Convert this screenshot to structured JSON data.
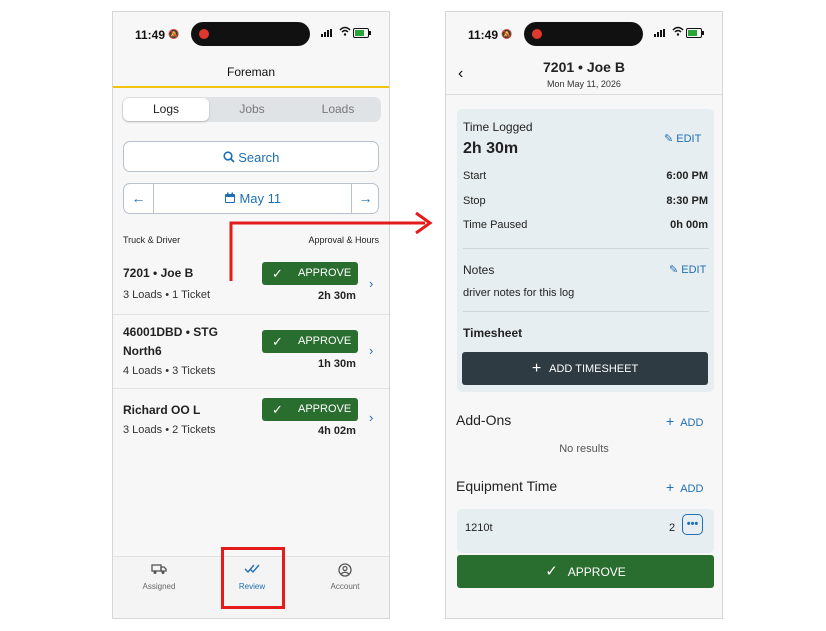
{
  "status": {
    "time": "11:49"
  },
  "left": {
    "header_title": "Foreman",
    "segments": [
      "Logs",
      "Jobs",
      "Loads"
    ],
    "search_label": "Search",
    "date_label": "May 11",
    "col_left": "Truck & Driver",
    "col_right": "Approval & Hours",
    "approve_label": "APPROVE",
    "rows": [
      {
        "title": "7201 • Joe B",
        "sub": "3 Loads • 1 Ticket",
        "hours": "2h 30m"
      },
      {
        "title": "46001DBD • STG North6",
        "sub": "4 Loads • 3 Tickets",
        "hours": "1h 30m"
      },
      {
        "title": "Richard OO L",
        "sub": "3 Loads • 2 Tickets",
        "hours": "4h 02m"
      }
    ],
    "tabs": [
      {
        "label": "Assigned",
        "icon": "truck-icon"
      },
      {
        "label": "Review",
        "icon": "double-check-icon"
      },
      {
        "label": "Account",
        "icon": "account-icon"
      }
    ]
  },
  "right": {
    "title": "7201 • Joe B",
    "date": "Mon May 11, 2026",
    "time_logged_label": "Time Logged",
    "time_logged_value": "2h 30m",
    "edit_label": "EDIT",
    "start_label": "Start",
    "start_value": "6:00 PM",
    "stop_label": "Stop",
    "stop_value": "8:30 PM",
    "paused_label": "Time Paused",
    "paused_value": "0h 00m",
    "notes_label": "Notes",
    "notes_text": "driver notes for this log",
    "timesheet_label": "Timesheet",
    "add_timesheet_label": "ADD TIMESHEET",
    "addons_label": "Add-Ons",
    "add_label": "ADD",
    "no_results": "No results",
    "equipment_label": "Equipment Time",
    "equipment_name": "1210t",
    "equipment_count": "2",
    "approve_label": "APPROVE"
  },
  "colors": {
    "accent": "#1f6fb2",
    "approve_green": "#2a6e2f",
    "highlight_red": "#e31b1b",
    "header_yellow": "#f1c40f"
  }
}
